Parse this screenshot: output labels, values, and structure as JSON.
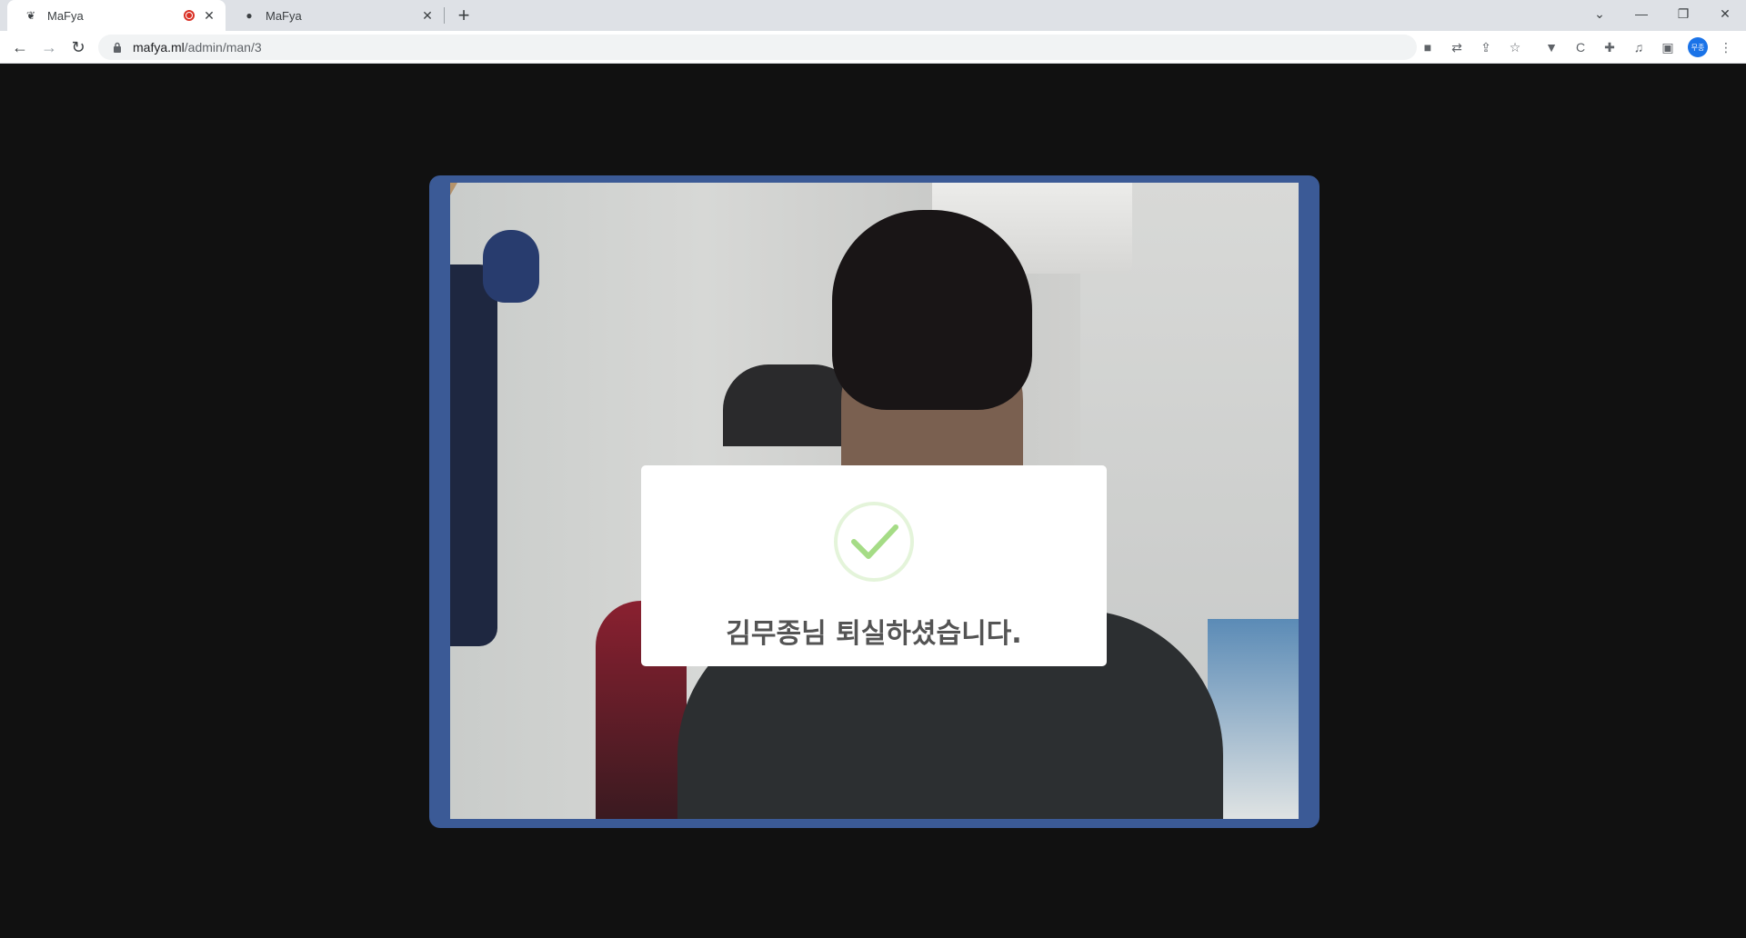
{
  "browser": {
    "tabs": [
      {
        "title": "MaFya",
        "favicon": "mafya-logo-icon",
        "recording": true,
        "active": true
      },
      {
        "title": "MaFya",
        "favicon": "globe-icon",
        "recording": false,
        "active": false
      }
    ],
    "url_host": "mafya.ml",
    "url_path": "/admin/man/3",
    "profile_initials": "무종",
    "toolbar_icons": [
      "camera-icon",
      "translate-icon",
      "share-icon",
      "bookmark-star-icon",
      "extension-v-icon",
      "extension-c-icon",
      "extensions-puzzle-icon",
      "media-queue-icon",
      "side-panel-icon",
      "profile-avatar",
      "menu-dots-icon"
    ]
  },
  "modal": {
    "icon": "success-check-icon",
    "title": "김무종님 퇴실하셨습니다.",
    "accent_color": "#a5dc86"
  },
  "video_frame_color": "#3b5a96"
}
